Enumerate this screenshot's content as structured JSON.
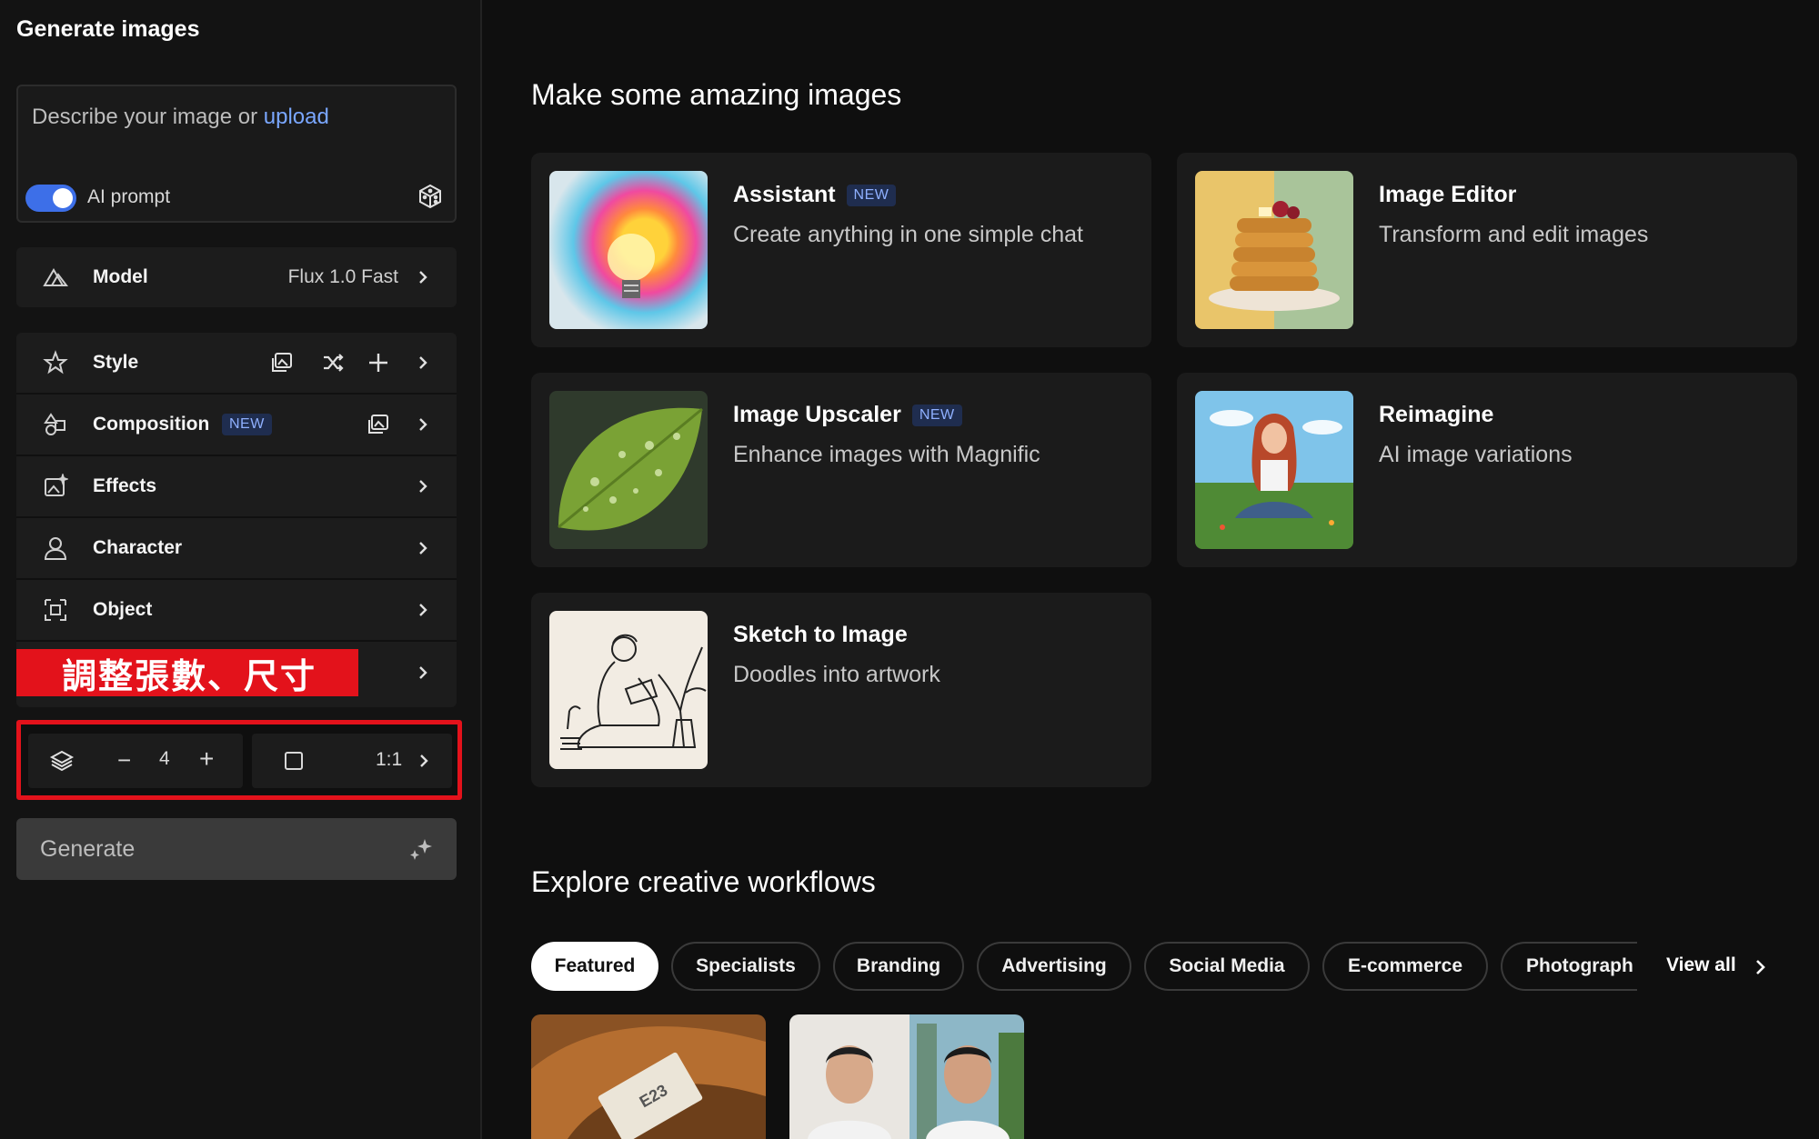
{
  "sidebar": {
    "title": "Generate images",
    "prompt": {
      "placeholder_prefix": "Describe your image or ",
      "upload_link": "upload",
      "toggle_label": "AI prompt",
      "toggle_on": true
    },
    "model": {
      "label": "Model",
      "value": "Flux 1.0 Fast"
    },
    "options": [
      {
        "label": "Style"
      },
      {
        "label": "Composition",
        "badge": "NEW"
      },
      {
        "label": "Effects"
      },
      {
        "label": "Character"
      },
      {
        "label": "Object"
      }
    ],
    "annotation": "調整張數、尺寸",
    "count": {
      "minus": "−",
      "value": "4",
      "plus": "+"
    },
    "ratio": {
      "value": "1:1"
    },
    "generate_label": "Generate"
  },
  "main": {
    "heading": "Make some amazing images",
    "cards": [
      {
        "title": "Assistant",
        "badge": "NEW",
        "desc": "Create anything in one simple chat",
        "icon": "lightbulb-image"
      },
      {
        "title": "Image Editor",
        "badge": "",
        "desc": "Transform and edit images",
        "icon": "pancakes-image"
      },
      {
        "title": "Image Upscaler",
        "badge": "NEW",
        "desc": "Enhance images with Magnific",
        "icon": "leaf-image"
      },
      {
        "title": "Reimagine",
        "badge": "",
        "desc": "AI image variations",
        "icon": "woman-image"
      },
      {
        "title": "Sketch to Image",
        "badge": "",
        "desc": "Doodles into artwork",
        "icon": "sketch-image"
      }
    ],
    "workflows_heading": "Explore creative workflows",
    "pills": [
      "Featured",
      "Specialists",
      "Branding",
      "Advertising",
      "Social Media",
      "E-commerce",
      "Photograph"
    ],
    "active_pill": "Featured",
    "view_all": "View all",
    "workflow_thumb_text": "E23"
  },
  "colors": {
    "accent_blue": "#3d6fe8",
    "annotation_red": "#e3121b",
    "badge_bg": "#1f2d4f",
    "badge_text": "#8fb0ff"
  }
}
